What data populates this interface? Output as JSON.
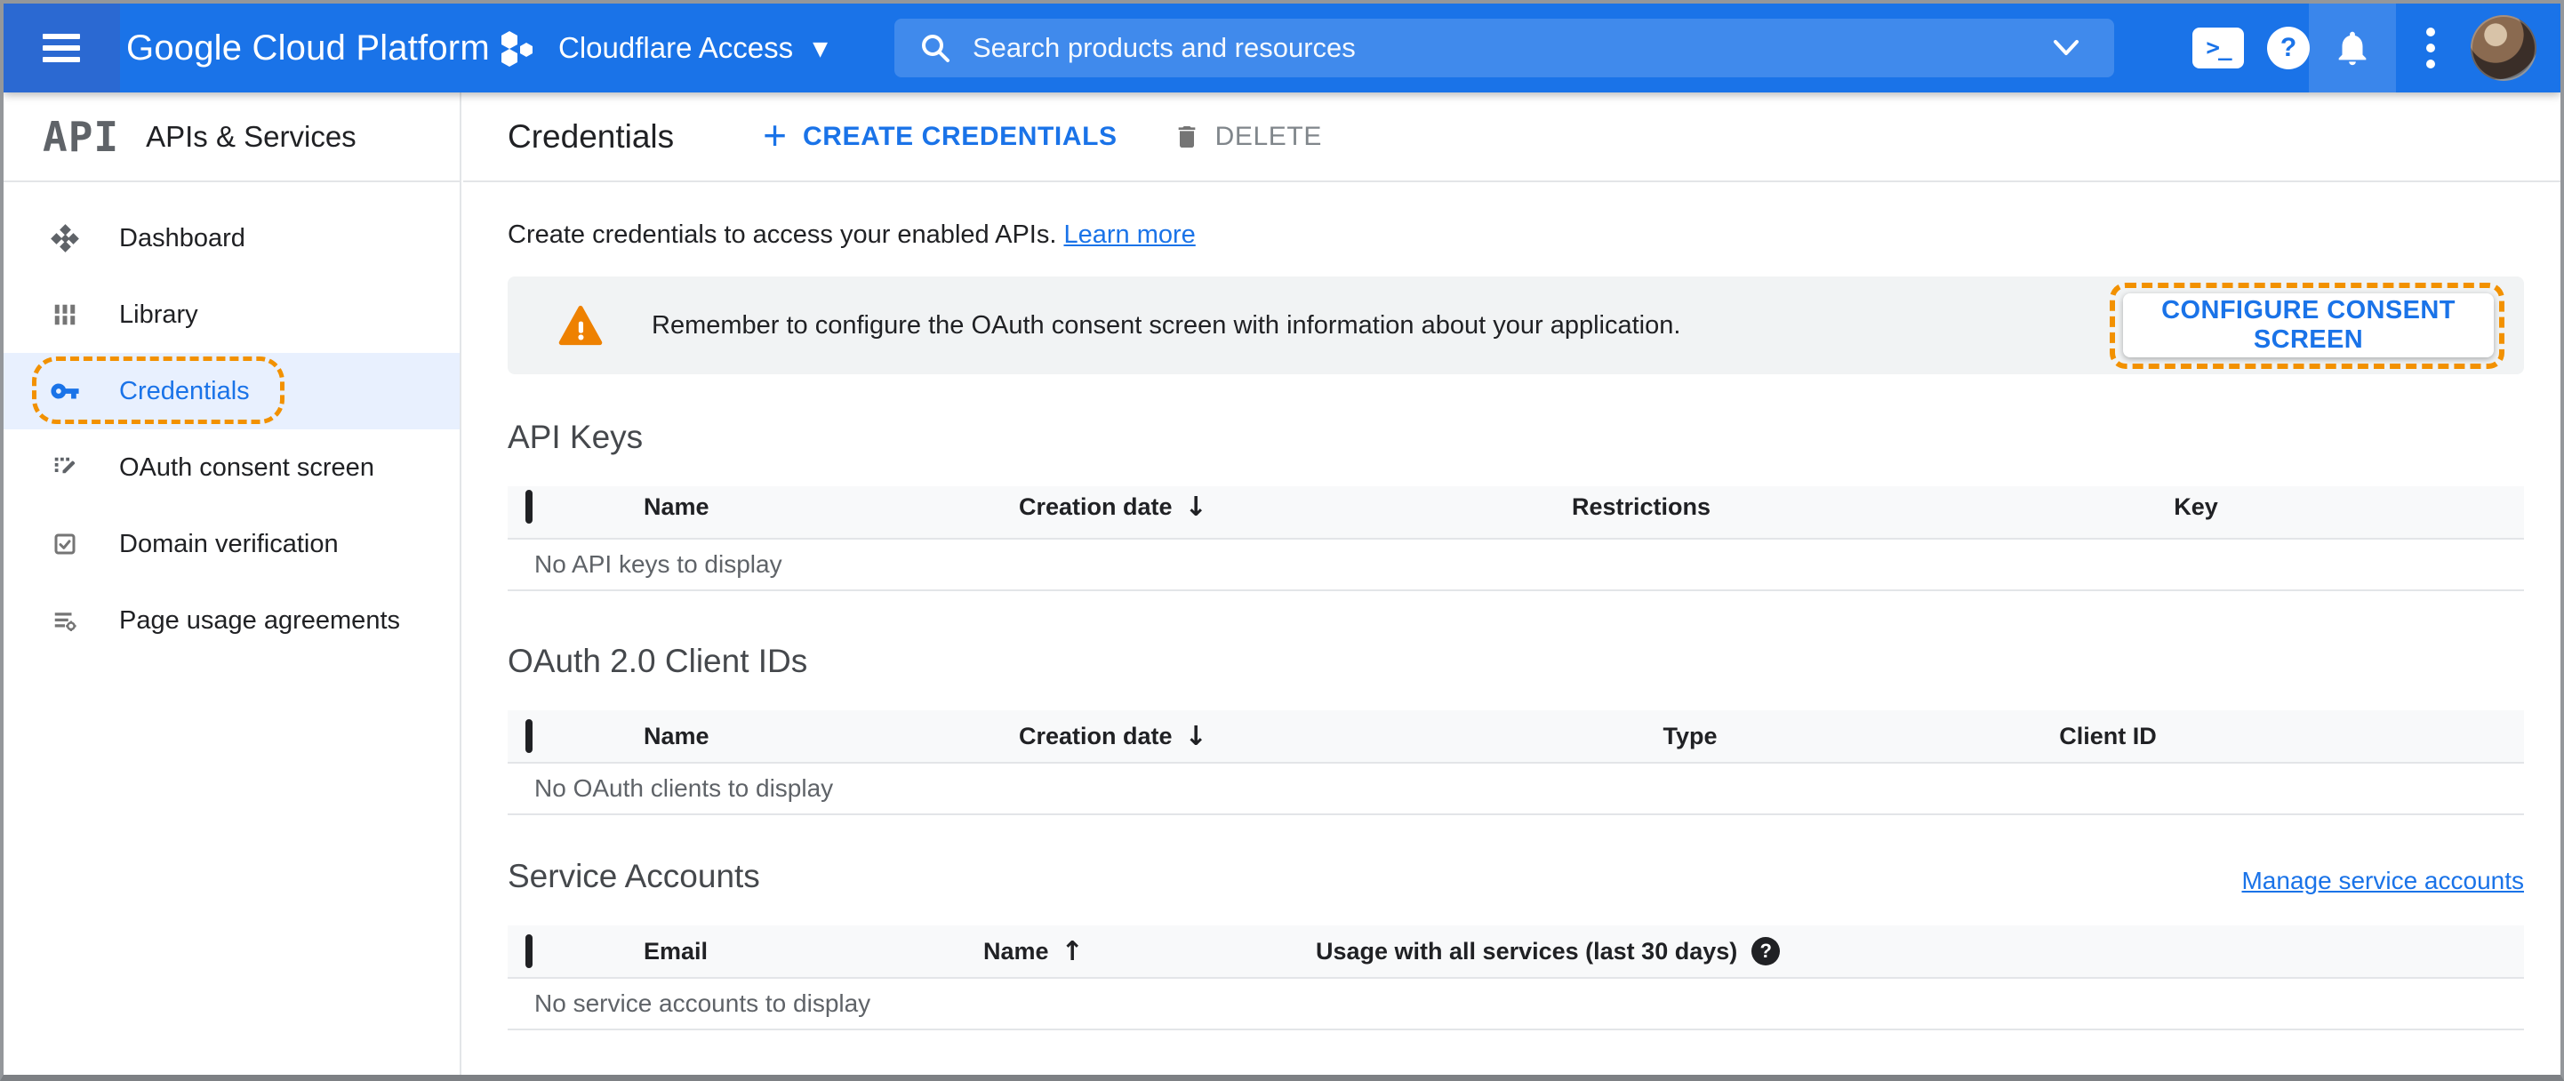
{
  "topbar": {
    "logo": "Google Cloud Platform",
    "project_name": "Cloudflare Access",
    "search_placeholder": "Search products and resources"
  },
  "sidebar": {
    "logo_text": "API",
    "title": "APIs & Services",
    "items": [
      {
        "label": "Dashboard",
        "selected": false
      },
      {
        "label": "Library",
        "selected": false
      },
      {
        "label": "Credentials",
        "selected": true
      },
      {
        "label": "OAuth consent screen",
        "selected": false
      },
      {
        "label": "Domain verification",
        "selected": false
      },
      {
        "label": "Page usage agreements",
        "selected": false
      }
    ]
  },
  "header": {
    "title": "Credentials",
    "create_label": "CREATE CREDENTIALS",
    "delete_label": "DELETE"
  },
  "intro": {
    "text": "Create credentials to access your enabled APIs.",
    "link_label": "Learn more"
  },
  "notice": {
    "message": "Remember to configure the OAuth consent screen with information about your application.",
    "action_label": "CONFIGURE CONSENT SCREEN"
  },
  "sections": {
    "api_keys": {
      "title": "API Keys",
      "columns": [
        "Name",
        "Creation date",
        "Restrictions",
        "Key"
      ],
      "empty": "No API keys to display"
    },
    "oauth_clients": {
      "title": "OAuth 2.0 Client IDs",
      "columns": [
        "Name",
        "Creation date",
        "Type",
        "Client ID"
      ],
      "empty": "No OAuth clients to display"
    },
    "service_accounts": {
      "title": "Service Accounts",
      "manage_link": "Manage service accounts",
      "columns": [
        "Email",
        "Name",
        "Usage with all services (last 30 days)"
      ],
      "empty": "No service accounts to display"
    }
  },
  "glyphs": {
    "plus": "+",
    "sort_down": "↓",
    "sort_up": "↑",
    "question": "?",
    "dropdown": "▼",
    "shell_prompt": ">_"
  },
  "colors": {
    "accent_blue": "#1a73e8",
    "annotation_orange": "#f29100",
    "warning_orange": "#ee8100",
    "selected_bg": "#e8f0fe",
    "notice_bg": "#f1f3f4",
    "table_header_bg": "#f8f9fa"
  }
}
